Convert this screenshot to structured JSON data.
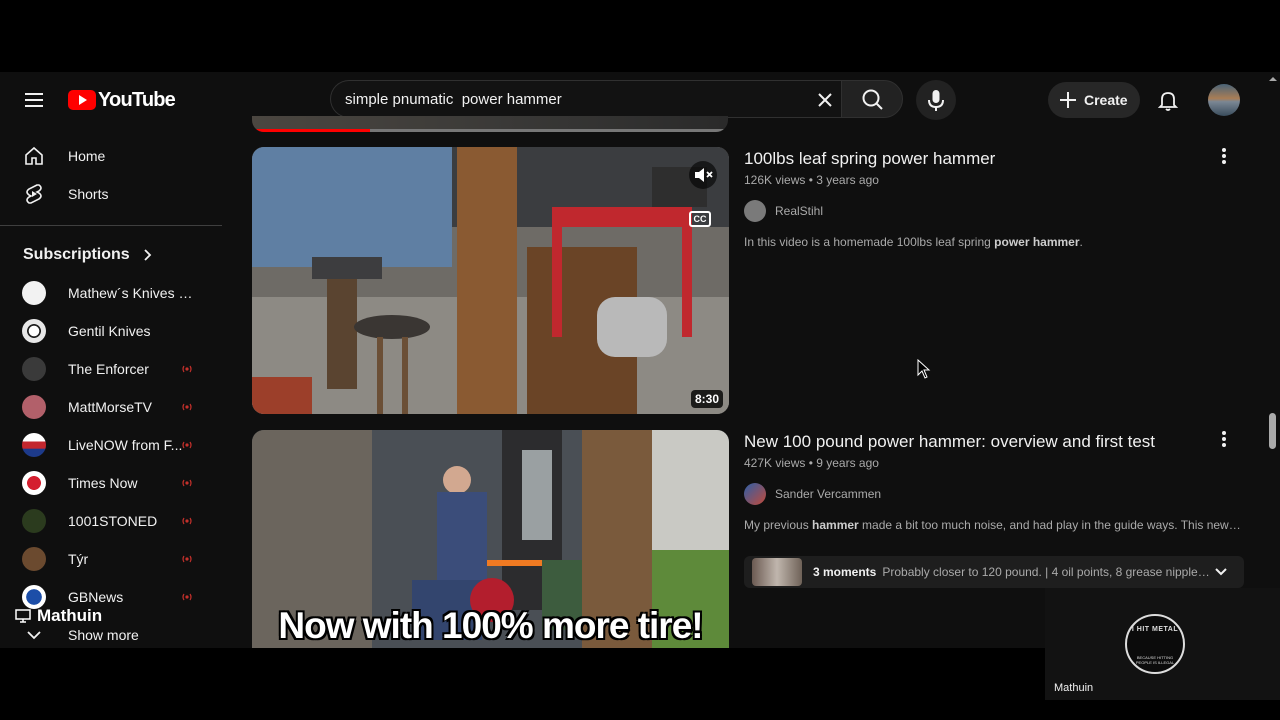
{
  "header": {
    "logo_text": "YouTube",
    "search": {
      "value": "simple pnumatic  power hammer",
      "placeholder": "Search"
    },
    "create_label": "Create"
  },
  "sidebar": {
    "items": [
      {
        "label": "Home",
        "icon": "home-icon"
      },
      {
        "label": "Shorts",
        "icon": "shorts-icon"
      }
    ],
    "subscriptions_label": "Subscriptions",
    "subscriptions": [
      {
        "label": "Mathew´s Knives & ...",
        "live": false,
        "color": "#f2f2f2"
      },
      {
        "label": "Gentil Knives",
        "live": false,
        "color": "#e8e8e8"
      },
      {
        "label": "The Enforcer",
        "live": true,
        "color": "#3a3a3a"
      },
      {
        "label": "MattMorseTV",
        "live": true,
        "color": "#b2606a"
      },
      {
        "label": "LiveNOW from F...",
        "live": true,
        "color": "#c3272e"
      },
      {
        "label": "Times Now",
        "live": true,
        "color": "#d41f2f"
      },
      {
        "label": "1001STONED",
        "live": true,
        "color": "#2b3b1e"
      },
      {
        "label": "Týr",
        "live": true,
        "color": "#6b4a2f"
      },
      {
        "label": "GBNews",
        "live": true,
        "color": "#1c4ea8"
      }
    ],
    "show_more_label": "Show more"
  },
  "results": [
    {
      "title": "100lbs leaf spring power hammer",
      "stats": "126K views • 3 years ago",
      "channel": "RealStihl",
      "description_plain": "In this video is a homemade 100lbs leaf spring ",
      "description_bold": "power hammer",
      "description_tail": ".",
      "duration": "8:30",
      "cc_label": "CC"
    },
    {
      "title": "New 100 pound power hammer: overview and first test",
      "stats": "427K views • 9 years ago",
      "channel": "Sander Vercammen",
      "description_plain": "My previous ",
      "description_bold": "hammer",
      "description_tail": " made a bit too much noise, and had play in the guide ways. This new one is...",
      "thumbnail_caption": "Now with 100% more tire!",
      "moments_count": "3 moments",
      "moments_text": "Probably closer to 120 pound. | 4 oil points, 8 grease nipples |..."
    }
  ],
  "overlays": {
    "streamer_name": "Mathuin",
    "cam_name": "Mathuin",
    "cam_logo_text": "I HIT METAL",
    "cam_logo_subtext": "BECAUSE HITTING PEOPLE IS ILLEGAL"
  },
  "colors": {
    "brand_red": "#ff0000",
    "background": "#0f0f0f",
    "live_red": "#c4302b"
  }
}
